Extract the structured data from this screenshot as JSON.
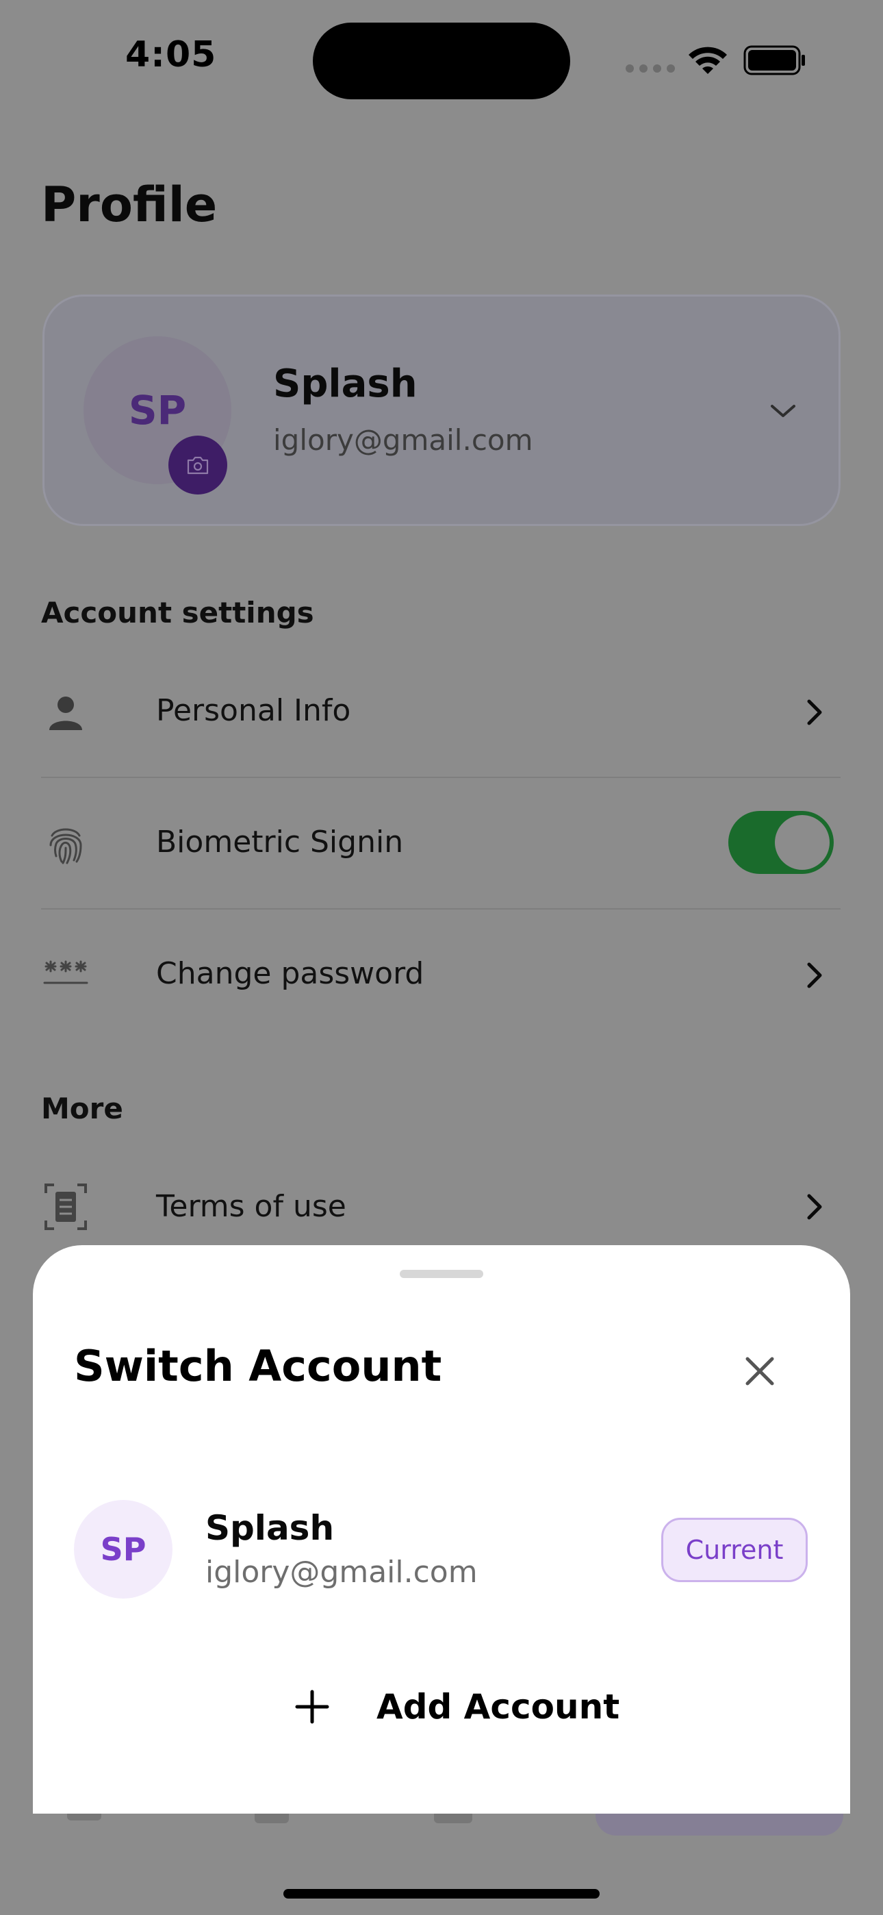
{
  "status_bar": {
    "time": "4:05",
    "icons": [
      "cellular-icon",
      "wifi-icon",
      "battery-icon"
    ]
  },
  "page": {
    "title": "Profile",
    "profile_card": {
      "initials": "SP",
      "name": "Splash",
      "email": "iglory@gmail.com",
      "icons": [
        "camera-icon",
        "chevron-down-icon"
      ]
    },
    "account_settings": {
      "heading": "Account settings",
      "items": [
        {
          "label": "Personal Info",
          "icon": "person-icon",
          "control": "chevron"
        },
        {
          "label": "Biometric Signin",
          "icon": "fingerprint-icon",
          "control": "toggle",
          "on": true
        },
        {
          "label": "Change password",
          "icon": "password-icon",
          "control": "chevron"
        }
      ]
    },
    "more": {
      "heading": "More",
      "items": [
        {
          "label": "Terms of use",
          "icon": "document-icon",
          "control": "chevron"
        }
      ]
    }
  },
  "sheet": {
    "title": "Switch Account",
    "account": {
      "initials": "SP",
      "name": "Splash",
      "email": "iglory@gmail.com",
      "badge": "Current"
    },
    "add_account_label": "Add Account"
  },
  "colors": {
    "accent_purple": "#7a3fc9",
    "toggle_green": "#2aa845",
    "overlay": "#8c8c8c",
    "sheet_bg": "#ffffff"
  }
}
